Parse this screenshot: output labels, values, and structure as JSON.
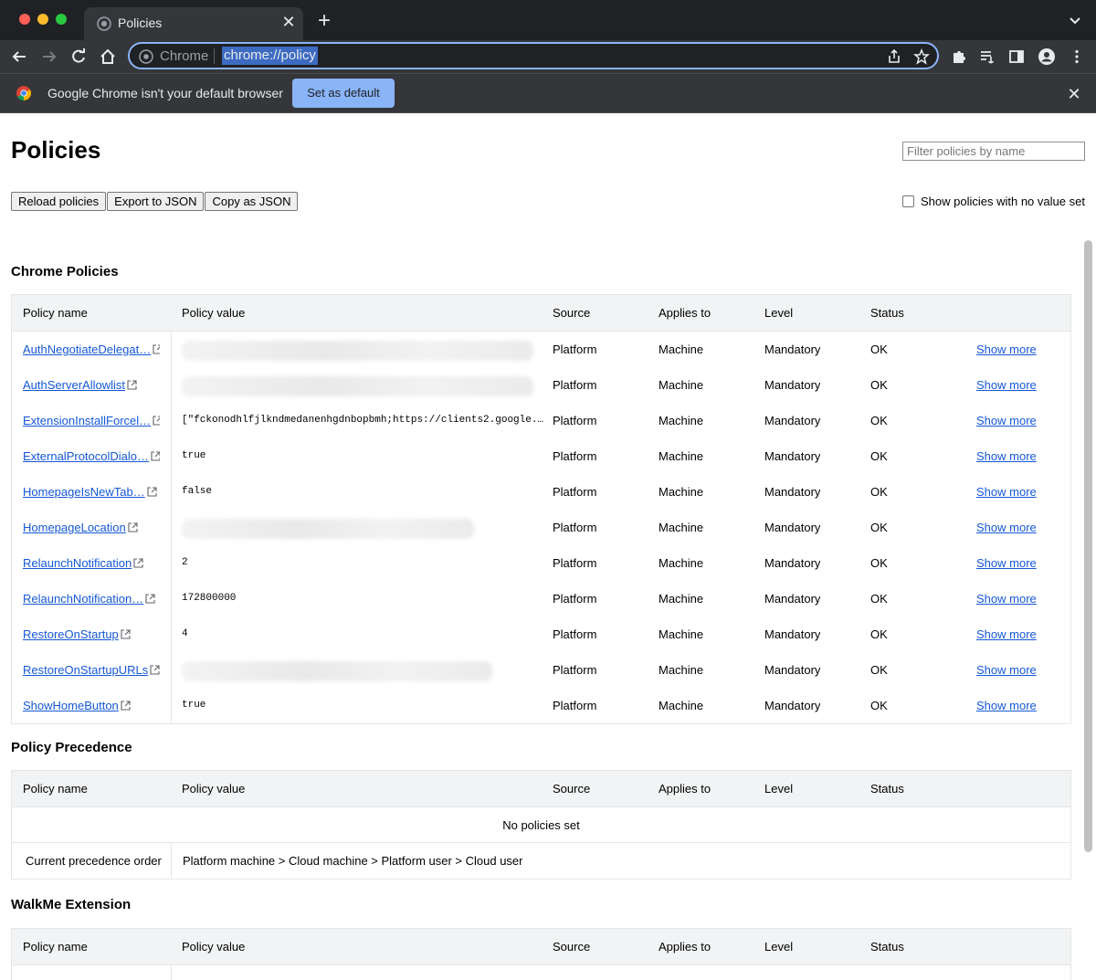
{
  "browser": {
    "tab_title": "Policies",
    "omnibox_chip": "Chrome",
    "url": "chrome://policy",
    "infobar_text": "Google Chrome isn't your default browser",
    "infobar_button": "Set as default"
  },
  "page": {
    "title": "Policies",
    "filter_placeholder": "Filter policies by name",
    "buttons": {
      "reload": "Reload policies",
      "export": "Export to JSON",
      "copy": "Copy as JSON"
    },
    "no_value_label": "Show policies with no value set"
  },
  "columns": {
    "name": "Policy name",
    "value": "Policy value",
    "source": "Source",
    "applies": "Applies to",
    "level": "Level",
    "status": "Status"
  },
  "chrome_policies": {
    "title": "Chrome Policies",
    "rows": [
      {
        "name": "AuthNegotiateDelegat…",
        "value": "",
        "blurred": true,
        "source": "Platform",
        "applies": "Machine",
        "level": "Mandatory",
        "status": "OK",
        "more": "Show more"
      },
      {
        "name": "AuthServerAllowlist",
        "value": "",
        "blurred": true,
        "source": "Platform",
        "applies": "Machine",
        "level": "Mandatory",
        "status": "OK",
        "more": "Show more"
      },
      {
        "name": "ExtensionInstallForcel…",
        "value": "[\"fckonodhlfjlkndmedanenhgdnbopbmh;https://clients2.google.…",
        "source": "Platform",
        "applies": "Machine",
        "level": "Mandatory",
        "status": "OK",
        "more": "Show more"
      },
      {
        "name": "ExternalProtocolDialo…",
        "value": "true",
        "source": "Platform",
        "applies": "Machine",
        "level": "Mandatory",
        "status": "OK",
        "more": "Show more"
      },
      {
        "name": "HomepageIsNewTab…",
        "value": "false",
        "source": "Platform",
        "applies": "Machine",
        "level": "Mandatory",
        "status": "OK",
        "more": "Show more"
      },
      {
        "name": "HomepageLocation",
        "value": "",
        "blurred": true,
        "source": "Platform",
        "applies": "Machine",
        "level": "Mandatory",
        "status": "OK",
        "more": "Show more"
      },
      {
        "name": "RelaunchNotification",
        "value": "2",
        "source": "Platform",
        "applies": "Machine",
        "level": "Mandatory",
        "status": "OK",
        "more": "Show more"
      },
      {
        "name": "RelaunchNotification…",
        "value": "172800000",
        "source": "Platform",
        "applies": "Machine",
        "level": "Mandatory",
        "status": "OK",
        "more": "Show more"
      },
      {
        "name": "RestoreOnStartup",
        "value": "4",
        "source": "Platform",
        "applies": "Machine",
        "level": "Mandatory",
        "status": "OK",
        "more": "Show more"
      },
      {
        "name": "RestoreOnStartupURLs",
        "value": "",
        "blurred": true,
        "source": "Platform",
        "applies": "Machine",
        "level": "Mandatory",
        "status": "OK",
        "more": "Show more"
      },
      {
        "name": "ShowHomeButton",
        "value": "true",
        "source": "Platform",
        "applies": "Machine",
        "level": "Mandatory",
        "status": "OK",
        "more": "Show more"
      }
    ]
  },
  "precedence": {
    "title": "Policy Precedence",
    "empty": "No policies set",
    "order_label": "Current precedence order",
    "order_value": "Platform machine > Cloud machine > Platform user > Cloud user"
  },
  "walkme": {
    "title": "WalkMe Extension"
  }
}
